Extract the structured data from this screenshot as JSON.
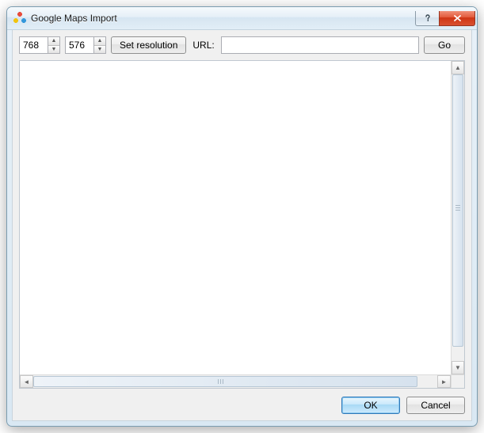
{
  "window": {
    "title": "Google Maps Import"
  },
  "toolbar": {
    "width_value": "768",
    "height_value": "576",
    "set_resolution_label": "Set resolution",
    "url_label": "URL:",
    "url_value": "",
    "go_label": "Go"
  },
  "footer": {
    "ok_label": "OK",
    "cancel_label": "Cancel"
  }
}
